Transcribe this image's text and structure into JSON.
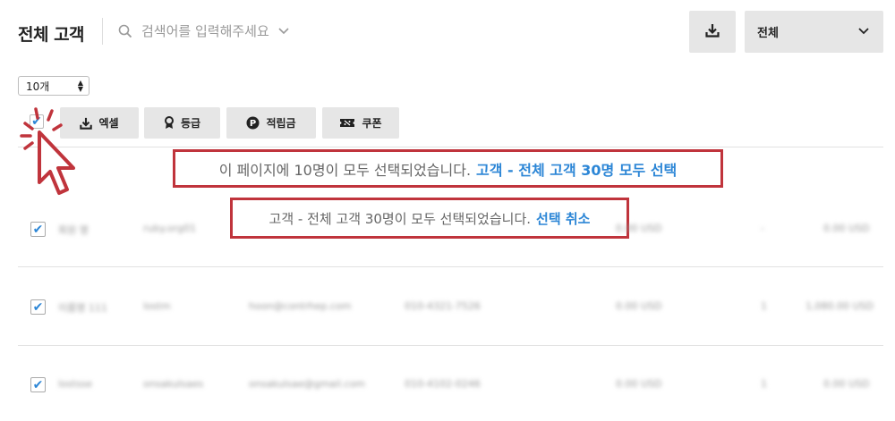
{
  "header": {
    "title": "전체 고객",
    "search_placeholder": "검색어를 입력해주세요",
    "filter_value": "전체"
  },
  "toolbar": {
    "page_size": "10개",
    "buttons": [
      {
        "label": "엑셀",
        "icon": "download-icon"
      },
      {
        "label": "등급",
        "icon": "medal-icon"
      },
      {
        "label": "적립금",
        "icon": "points-icon"
      },
      {
        "label": "쿠폰",
        "icon": "coupon-icon"
      }
    ]
  },
  "notices": {
    "page_selected": {
      "text": "이 페이지에 10명이 모두 선택되었습니다.",
      "link": "고객 - 전체 고객 30명 모두 선택"
    },
    "all_selected": {
      "text": "고객 - 전체 고객 30명이 모두 선택되었습니다.",
      "link": "선택 취소"
    }
  },
  "rows": [
    {
      "checked": true,
      "cells": [
        "회원 명",
        "ruby.org01",
        "",
        "",
        "0.00 USD",
        "-",
        "0.00 USD"
      ]
    },
    {
      "checked": true,
      "cells": [
        "이름명 111",
        "lostm",
        "hoon@contrhep.com",
        "010-4321-7526",
        "0.00 USD",
        "1",
        "1,080.00 USD"
      ]
    },
    {
      "checked": true,
      "cells": [
        "lostsse",
        "onsakulsaes",
        "onsakulsae@gmail.com",
        "010-4102-0246",
        "0.00 USD",
        "1",
        "0.00 USD"
      ]
    }
  ],
  "colors": {
    "accent": "#2c86d6",
    "highlight_border": "#c0343c",
    "button_bg": "#e6e6e6"
  }
}
